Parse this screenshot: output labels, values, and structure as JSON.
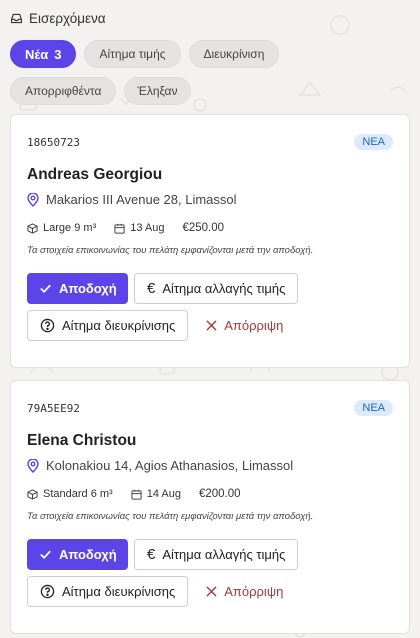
{
  "header": {
    "title": "Εισερχόμενα",
    "icon": "inbox-icon"
  },
  "filters": [
    {
      "label": "Νέα",
      "count": "3",
      "active": true
    },
    {
      "label": "Αίτημα τιμής"
    },
    {
      "label": "Διευκρίνιση"
    },
    {
      "label": "Απορριφθέντα"
    },
    {
      "label": "Έληξαν"
    }
  ],
  "colors": {
    "accent": "#5b45e8",
    "badge_bg": "#dbeafe",
    "badge_text": "#2563b8",
    "reject": "#a23a3a"
  },
  "cards": [
    {
      "ref": "18650723",
      "badge": "ΝΕΑ",
      "name": "Andreas Georgiou",
      "address": "Makarios III Avenue 28, Limassol",
      "size": "Large 9 m³",
      "date": "13 Aug",
      "price": "€250.00",
      "note": "Τα στοιχεία επικοινωνίας του πελάτη εμφανίζονται μετά την αποδοχή.",
      "accept": "Αποδοχή",
      "price_request": "Αίτημα αλλαγής τιμής",
      "clarify": "Αίτημα διευκρίνισης",
      "reject": "Απόρριψη"
    },
    {
      "ref": "79A5EE92",
      "badge": "ΝΕΑ",
      "name": "Elena Christou",
      "address": "Kolonakiou 14, Agios Athanasios, Limassol",
      "size": "Standard 6 m³",
      "date": "14 Aug",
      "price": "€200.00",
      "note": "Τα στοιχεία επικοινωνίας του πελάτη εμφανίζονται μετά την αποδοχή.",
      "accept": "Αποδοχή",
      "price_request": "Αίτημα αλλαγής τιμής",
      "clarify": "Αίτημα διευκρίνισης",
      "reject": "Απόρριψη"
    }
  ]
}
